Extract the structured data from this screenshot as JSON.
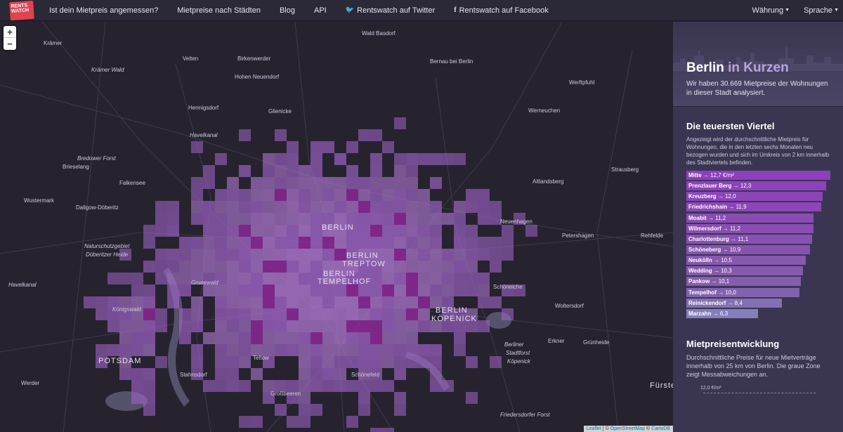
{
  "nav": {
    "logo_text": "RENTS WATCH",
    "links": [
      {
        "label": "Ist dein Mietpreis angemessen?"
      },
      {
        "label": "Mietpreise nach Städten"
      },
      {
        "label": "Blog"
      },
      {
        "label": "API"
      },
      {
        "label": "Rentswatch auf Twitter",
        "icon": "twitter-icon"
      },
      {
        "label": "Rentswatch auf Facebook",
        "icon": "facebook-icon"
      }
    ],
    "right": [
      {
        "label": "Währung"
      },
      {
        "label": "Sprache"
      }
    ]
  },
  "map": {
    "zoom_in": "+",
    "zoom_out": "−",
    "labels": [
      {
        "text": "Wald Basdorf",
        "cls": ""
      },
      {
        "text": "Krämer",
        "cls": ""
      },
      {
        "text": "Krämer Wald",
        "cls": "italic"
      },
      {
        "text": "Velten",
        "cls": ""
      },
      {
        "text": "Birkenwerder",
        "cls": ""
      },
      {
        "text": "Hohen Neuendorf",
        "cls": ""
      },
      {
        "text": "Bernau bei Berlin",
        "cls": ""
      },
      {
        "text": "Werftpfuhl",
        "cls": ""
      },
      {
        "text": "Hennigsdorf",
        "cls": ""
      },
      {
        "text": "Glienicke",
        "cls": ""
      },
      {
        "text": "Werneuchen",
        "cls": ""
      },
      {
        "text": "Havelkanal",
        "cls": "italic"
      },
      {
        "text": "Brieselang",
        "cls": ""
      },
      {
        "text": "Bredower Forst",
        "cls": "italic"
      },
      {
        "text": "Falkensee",
        "cls": ""
      },
      {
        "text": "Altlandsberg",
        "cls": ""
      },
      {
        "text": "Strausberg",
        "cls": ""
      },
      {
        "text": "Wustermark",
        "cls": ""
      },
      {
        "text": "Dallgow-Döberitz",
        "cls": ""
      },
      {
        "text": "BERLIN",
        "cls": "big"
      },
      {
        "text": "Neuenhagen",
        "cls": ""
      },
      {
        "text": "Petershagen",
        "cls": ""
      },
      {
        "text": "Rehfelde",
        "cls": ""
      },
      {
        "text": "Naturschutzgebiet",
        "cls": "italic"
      },
      {
        "text": "Döberitzer Heide",
        "cls": "italic"
      },
      {
        "text": "BERLIN",
        "cls": "big"
      },
      {
        "text": "TREPTOW",
        "cls": "big"
      },
      {
        "text": "BERLIN",
        "cls": "big"
      },
      {
        "text": "TEMPELHOF",
        "cls": "big"
      },
      {
        "text": "Grunewald",
        "cls": "italic"
      },
      {
        "text": "Schöneiche",
        "cls": ""
      },
      {
        "text": "Königswald",
        "cls": "italic"
      },
      {
        "text": "BERLIN",
        "cls": "big"
      },
      {
        "text": "KÖPENICK",
        "cls": "big"
      },
      {
        "text": "Woltersdorf",
        "cls": ""
      },
      {
        "text": "Erkner",
        "cls": ""
      },
      {
        "text": "Grünheide",
        "cls": ""
      },
      {
        "text": "POTSDAM",
        "cls": "big"
      },
      {
        "text": "Teltow",
        "cls": ""
      },
      {
        "text": "Berliner",
        "cls": "italic"
      },
      {
        "text": "Stadtforst",
        "cls": "italic"
      },
      {
        "text": "Köpenick",
        "cls": "italic"
      },
      {
        "text": "Stahnsdorf",
        "cls": ""
      },
      {
        "text": "Schönefeld",
        "cls": ""
      },
      {
        "text": "Werder",
        "cls": ""
      },
      {
        "text": "Großbeeren",
        "cls": ""
      },
      {
        "text": "Fürstenw",
        "cls": "big"
      },
      {
        "text": "Friedersdorfer Forst",
        "cls": "italic"
      },
      {
        "text": "Havelkanal",
        "cls": "italic"
      }
    ],
    "attribution": {
      "leaflet": "Leaflet",
      "sep1": " | © ",
      "osm": "OpenStreetMap",
      "sep2": " © ",
      "carto": "CartoDB"
    }
  },
  "sidebar": {
    "city": "Berlin",
    "title_rest": " in Kurzen",
    "subtitle": "Wir haben 30.669 Mietpreise der Wohnungen in dieser Stadt analysiert.",
    "expensive": {
      "heading": "Die teuersten Viertel",
      "description": "Angezeigt wird der durchschnittliche Mietpreis für Wohnungen, die in den letzten sechs Monaten neu bezogen wurden und sich im Umkreis von 2 km innerhalb des Stadtviertels befinden.",
      "items": [
        {
          "name": "Mitte",
          "value": "12,7 €/m²",
          "fraction": 1.0,
          "color": "#8e3fbe"
        },
        {
          "name": "Prenzlauer Berg",
          "value": "12,3",
          "fraction": 0.97,
          "color": "#8d42bb"
        },
        {
          "name": "Kreuzberg",
          "value": "12,0",
          "fraction": 0.945,
          "color": "#8c45b8"
        },
        {
          "name": "Friedrichshain",
          "value": "11,9",
          "fraction": 0.937,
          "color": "#8b47b6"
        },
        {
          "name": "Moabit",
          "value": "11,2",
          "fraction": 0.882,
          "color": "#8a4cb3"
        },
        {
          "name": "Wilmersdorf",
          "value": "11,2",
          "fraction": 0.882,
          "color": "#894eb2"
        },
        {
          "name": "Charlottenburg",
          "value": "11,1",
          "fraction": 0.874,
          "color": "#8850b2"
        },
        {
          "name": "Schöneberg",
          "value": "10,9",
          "fraction": 0.858,
          "color": "#8753b0"
        },
        {
          "name": "Neukölln",
          "value": "10,5",
          "fraction": 0.827,
          "color": "#8658ae"
        },
        {
          "name": "Wedding",
          "value": "10,3",
          "fraction": 0.811,
          "color": "#855bad"
        },
        {
          "name": "Pankow",
          "value": "10,1",
          "fraction": 0.795,
          "color": "#845ead"
        },
        {
          "name": "Tempelhof",
          "value": "10,0",
          "fraction": 0.787,
          "color": "#8362ad"
        },
        {
          "name": "Reinickendorf",
          "value": "8,4",
          "fraction": 0.661,
          "color": "#8370b1"
        },
        {
          "name": "Marzahn",
          "value": "6,3",
          "fraction": 0.496,
          "color": "#8580bb"
        }
      ]
    },
    "trend": {
      "heading": "Mietpreisentwicklung",
      "description": "Durchschnittliche Preise für neue Mietverträge innerhalb von 25 km von Berlin. Die graue Zone zeigt Messabweichungen an.",
      "tick_label": "12,0 €/m²"
    }
  }
}
